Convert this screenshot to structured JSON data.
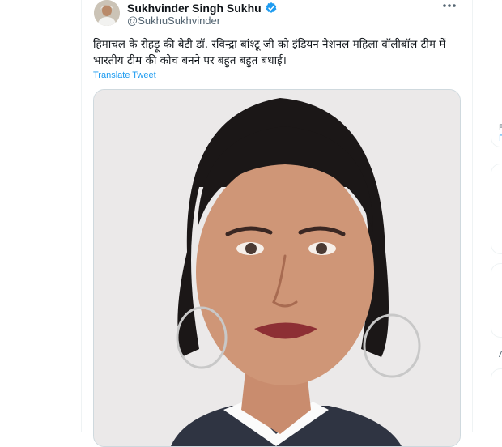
{
  "tweet": {
    "display_name": "Sukhvinder Singh Sukhu",
    "handle": "@SukhuSukhvinder",
    "verified": true,
    "text": "हिमाचल के रोहड़ू की बेटी डॉ. रविन्द्रा बांश्टू जी को इंडियन नेशनल महिला वॉलीबॉल टीम में भारतीय टीम की कोच बनने पर बहुत बहुत बधाई।",
    "translate_label": "Translate Tweet"
  },
  "icons": {
    "verified": "verified-badge-icon",
    "more": "more-options-icon"
  },
  "colors": {
    "accent": "#1d9bf0",
    "text": "#0f1419",
    "secondary_text": "#536471",
    "border": "#cfd9de"
  },
  "right_rail": {
    "fragment_1": "E",
    "fragment_2": "F",
    "fragment_3": "A"
  }
}
